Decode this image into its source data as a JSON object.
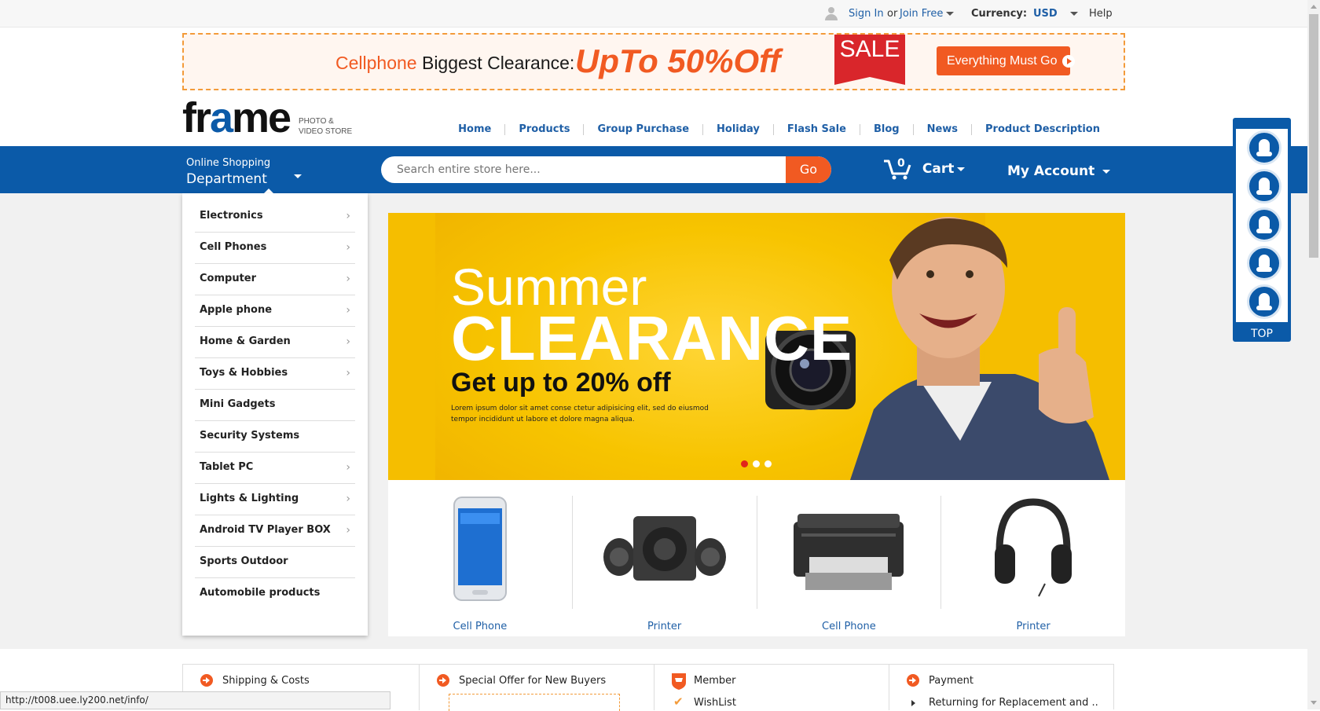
{
  "topbar": {
    "sign_in": "Sign In",
    "or": "or",
    "join_free": "Join Free",
    "currency_label": "Currency:",
    "currency_value": "USD",
    "help": "Help"
  },
  "banner": {
    "cellphone": "Cellphone",
    "biggest_clearance": "Biggest Clearance:",
    "upto": "UpTo 50%Off",
    "sale": "SALE",
    "cta": "Everything Must Go"
  },
  "logo": {
    "wordmark_a": "fr",
    "wordmark_b": "a",
    "wordmark_c": "me",
    "sub1": "PHOTO &",
    "sub2": "VIDEO STORE"
  },
  "nav": [
    "Home",
    "Products",
    "Group Purchase",
    "Holiday",
    "Flash Sale",
    "Blog",
    "News",
    "Product Description"
  ],
  "department": {
    "small": "Online Shopping",
    "large": "Department"
  },
  "search": {
    "placeholder": "Search entire store here...",
    "button": "Go"
  },
  "cart": {
    "count": "0",
    "label": "Cart"
  },
  "account": {
    "label": "My Account"
  },
  "categories": [
    {
      "label": "Electronics",
      "arrow": true
    },
    {
      "label": "Cell Phones",
      "arrow": true
    },
    {
      "label": "Computer",
      "arrow": true
    },
    {
      "label": "Apple phone",
      "arrow": true
    },
    {
      "label": "Home & Garden",
      "arrow": true
    },
    {
      "label": "Toys & Hobbies",
      "arrow": true
    },
    {
      "label": "Mini Gadgets",
      "arrow": false
    },
    {
      "label": "Security Systems",
      "arrow": false
    },
    {
      "label": "Tablet PC",
      "arrow": true
    },
    {
      "label": "Lights & Lighting",
      "arrow": true
    },
    {
      "label": "Android TV Player BOX",
      "arrow": true
    },
    {
      "label": "Sports Outdoor",
      "arrow": false
    },
    {
      "label": "Automobile products",
      "arrow": false
    }
  ],
  "hero": {
    "line1": "Summer",
    "line2": "CLEARANCE",
    "line3": "Get up to 20% off",
    "body": "Lorem ipsum dolor sit amet conse ctetur adipisicing elit, sed do eiusmod tempor incididunt ut labore et dolore magna aliqua.",
    "active_slide": 1,
    "slide_count": 3
  },
  "products": [
    {
      "caption": "Cell Phone",
      "icon": "smartphone-icon"
    },
    {
      "caption": "Printer",
      "icon": "speakers-icon"
    },
    {
      "caption": "Cell Phone",
      "icon": "printer-icon"
    },
    {
      "caption": "Printer",
      "icon": "headphones-icon"
    }
  ],
  "floating": {
    "top_label": "TOP",
    "buttons": 5
  },
  "footer": {
    "col1": {
      "title": "Shipping & Costs"
    },
    "col2": {
      "title": "Special Offer for New Buyers"
    },
    "col3": {
      "title": "Member",
      "sub": "WishList"
    },
    "col4": {
      "title": "Payment",
      "sub": "Returning for Replacement and .."
    }
  },
  "status_url": "http://t008.uee.ly200.net/info/",
  "colors": {
    "brand_blue": "#0b5aa8",
    "accent_orange": "#f15a22",
    "hero_yellow": "#f5be00"
  }
}
